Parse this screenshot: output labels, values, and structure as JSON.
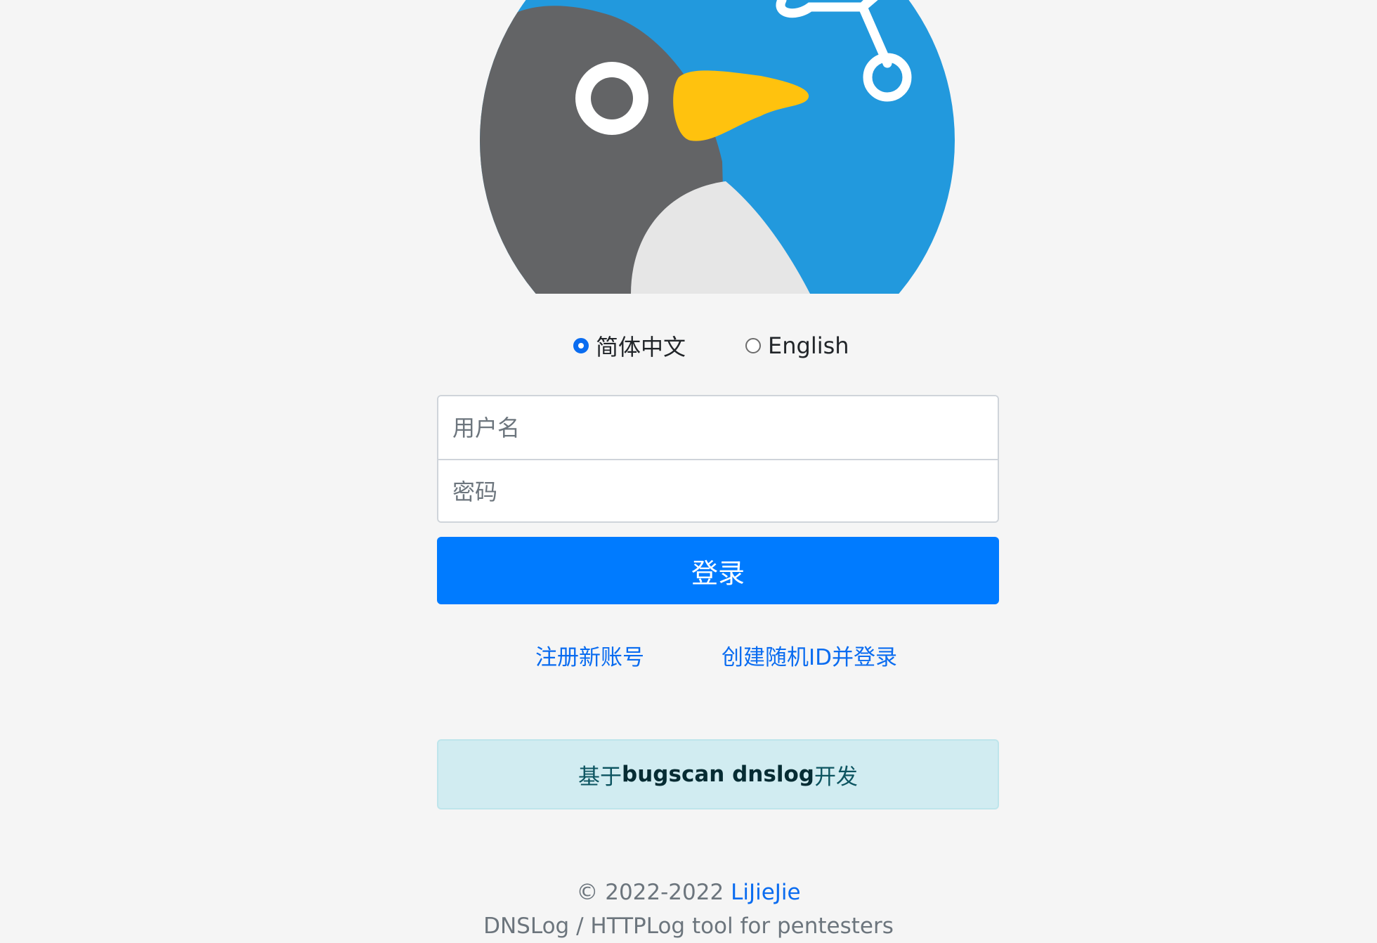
{
  "colors": {
    "background": "#f5f5f5",
    "primary": "#007bff",
    "link": "#0a6cf0",
    "info_bg": "#d1ecf1",
    "info_text": "#0c5460",
    "logo_blue": "#2299dd",
    "logo_grey": "#636466",
    "logo_beak": "#ffc20e"
  },
  "logo": {
    "icon": "penguin-logo-icon"
  },
  "language": {
    "options": [
      {
        "label": "简体中文",
        "selected": true
      },
      {
        "label": "English",
        "selected": false
      }
    ]
  },
  "form": {
    "username_placeholder": "用户名",
    "username_value": "",
    "password_placeholder": "密码",
    "password_value": "",
    "login_label": "登录"
  },
  "links": {
    "register": "注册新账号",
    "random_id": "创建随机ID并登录"
  },
  "info": {
    "prefix": "基于",
    "bold": "bugscan dnslog",
    "suffix": "开发"
  },
  "footer": {
    "copyright": "© 2022-2022 ",
    "author": "LiJieJie",
    "tagline": "DNSLog / HTTPLog tool for pentesters"
  }
}
